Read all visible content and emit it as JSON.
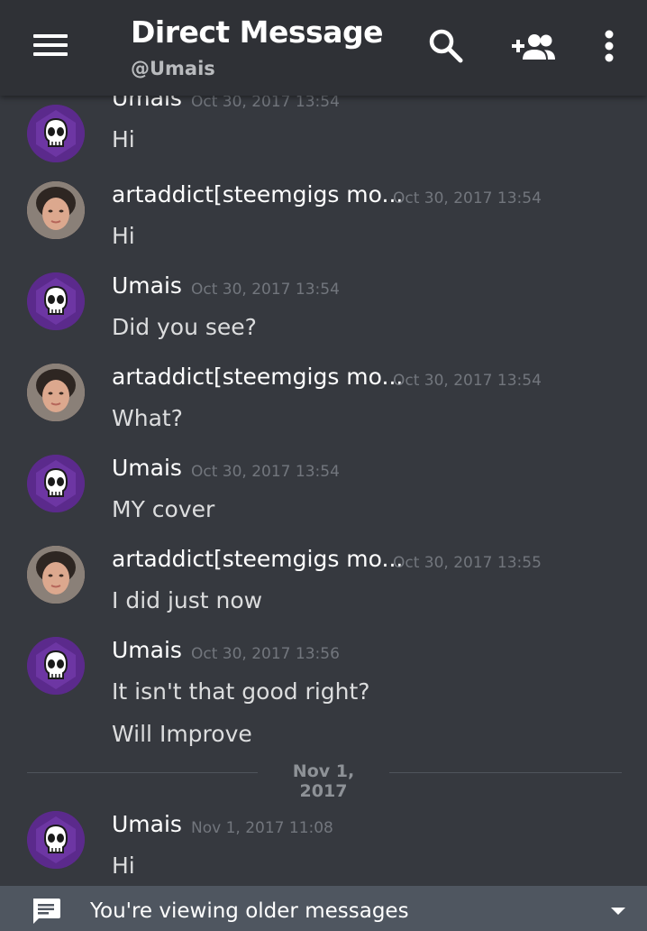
{
  "header": {
    "title": "Direct Message",
    "subtitle": "@Umais",
    "icons": [
      "menu-icon",
      "search-icon",
      "add-friend-icon",
      "more-vertical-icon"
    ]
  },
  "messages": [
    {
      "author": "Umais",
      "time": "Oct 30, 2017 13:54",
      "avatar": "skull-avatar",
      "lines": [
        "Hi"
      ]
    },
    {
      "author": "artaddict[steemgigs mo...",
      "time": "Oct 30, 2017 13:54",
      "avatar": "photo-avatar",
      "lines": [
        "Hi"
      ]
    },
    {
      "author": "Umais",
      "time": "Oct 30, 2017 13:54",
      "avatar": "skull-avatar",
      "lines": [
        "Did you see?"
      ]
    },
    {
      "author": "artaddict[steemgigs mo...",
      "time": "Oct 30, 2017 13:54",
      "avatar": "photo-avatar",
      "lines": [
        "What?"
      ]
    },
    {
      "author": "Umais",
      "time": "Oct 30, 2017 13:54",
      "avatar": "skull-avatar",
      "lines": [
        "MY cover"
      ]
    },
    {
      "author": "artaddict[steemgigs mo...",
      "time": "Oct 30, 2017 13:55",
      "avatar": "photo-avatar",
      "lines": [
        "I did just now"
      ]
    },
    {
      "author": "Umais",
      "time": "Oct 30, 2017 13:56",
      "avatar": "skull-avatar",
      "lines": [
        "It isn't that good right?",
        "Will Improve"
      ]
    },
    {
      "author": "Umais",
      "time": "Nov 1, 2017 11:08",
      "avatar": "skull-avatar",
      "lines": [
        "Hi"
      ]
    }
  ],
  "date_divider": "Nov 1, 2017",
  "bottom_bar": {
    "text": "You're viewing older messages",
    "icon": "chat-icon"
  },
  "colors": {
    "background": "#36393f",
    "header": "#2f3136",
    "bottom_bar": "#4f5660",
    "timestamp": "#72767d",
    "skull_avatar": "#5b2a8c"
  }
}
